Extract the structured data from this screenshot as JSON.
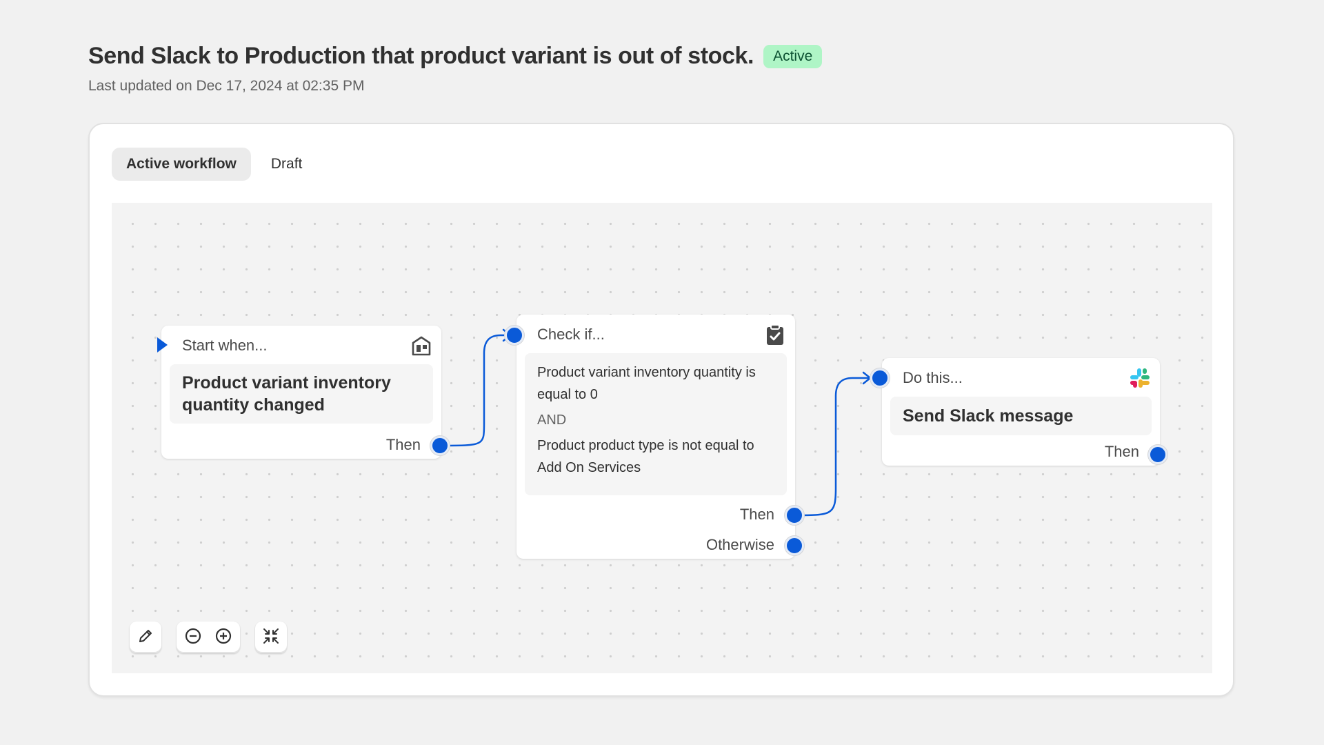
{
  "header": {
    "title": "Send Slack to Production that product variant is out of stock.",
    "status": "Active",
    "updated": "Last updated on Dec 17, 2024 at 02:35 PM"
  },
  "tabs": [
    {
      "label": "Active workflow",
      "active": true
    },
    {
      "label": "Draft",
      "active": false
    }
  ],
  "nodes": {
    "trigger": {
      "heading": "Start when...",
      "title": "Product variant inventory quantity changed",
      "output": "Then",
      "icon": "store-icon"
    },
    "condition": {
      "heading": "Check if...",
      "clause1": "Product variant inventory quantity is equal to 0",
      "operator": "AND",
      "clause2": "Product product type is not equal to Add On Services",
      "output_then": "Then",
      "output_otherwise": "Otherwise",
      "icon": "clipboard-check-icon"
    },
    "action": {
      "heading": "Do this...",
      "title": "Send Slack message",
      "output": "Then",
      "icon": "slack-icon"
    }
  },
  "controls": {
    "icons": [
      "pencil-icon",
      "zoom-out-icon",
      "zoom-in-icon",
      "collapse-icon"
    ]
  },
  "colors": {
    "accent": "#0a5ad8",
    "badge_bg": "#aff5c6",
    "badge_text": "#0c5132"
  }
}
